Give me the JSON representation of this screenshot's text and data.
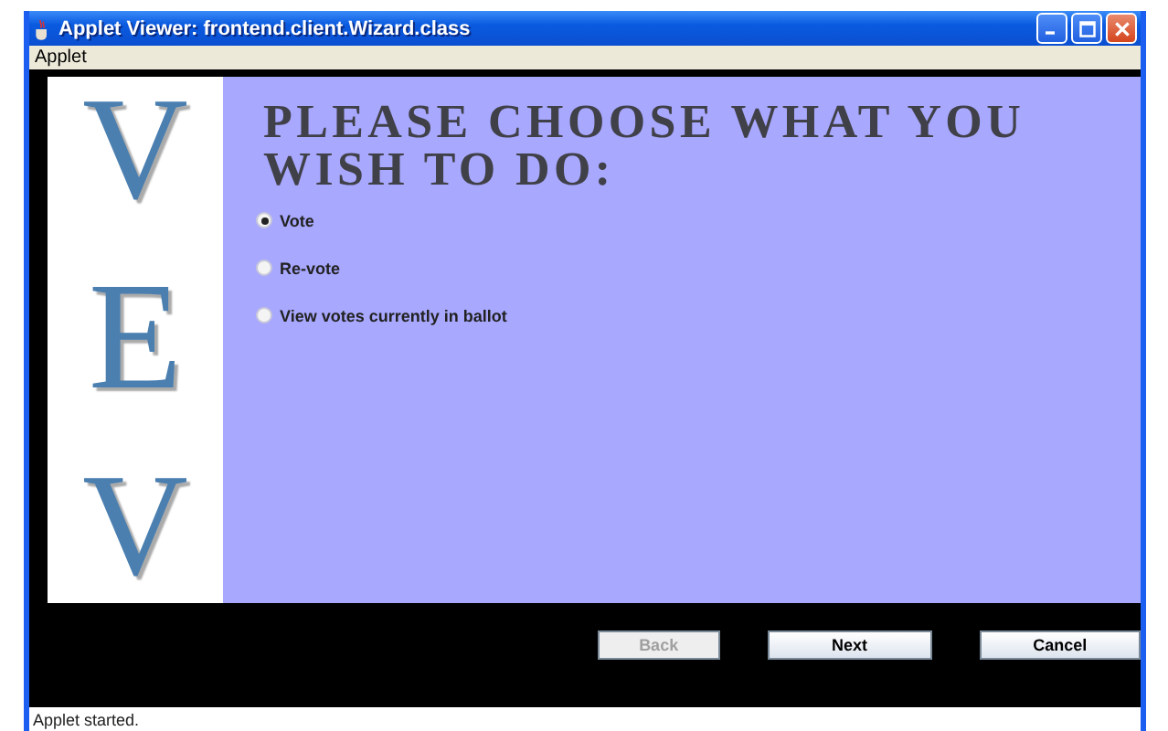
{
  "window": {
    "title": "Applet Viewer: frontend.client.Wizard.class"
  },
  "menu": [
    "Applet"
  ],
  "logo_letters": [
    "V",
    "E",
    "V"
  ],
  "heading": "PLEASE CHOOSE WHAT YOU WISH TO DO:",
  "options": [
    {
      "label": "Vote",
      "selected": true
    },
    {
      "label": "Re-vote",
      "selected": false
    },
    {
      "label": "View votes currently in ballot",
      "selected": false
    }
  ],
  "buttons": [
    {
      "label": "Back",
      "disabled": true
    },
    {
      "label": "Next",
      "disabled": false
    },
    {
      "label": "Cancel",
      "disabled": false
    }
  ],
  "status_bar": "Applet started."
}
